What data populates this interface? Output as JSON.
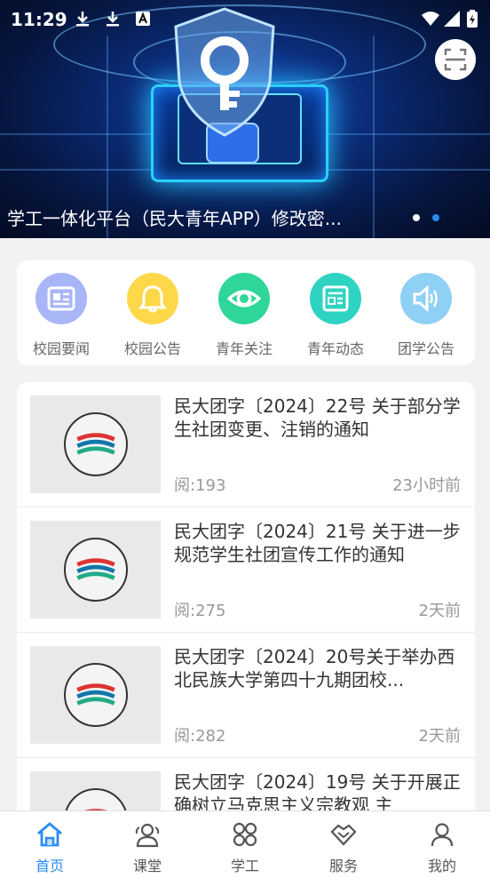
{
  "status_bar": {
    "time": "11:29"
  },
  "banner": {
    "caption": "学工一体化平台（民大青年APP）修改密...",
    "dots": 2,
    "active_dot": 2
  },
  "quick_menu": [
    {
      "label": "校园要闻",
      "icon": "newspaper-icon",
      "color": "#a8b5f6"
    },
    {
      "label": "校园公告",
      "icon": "bell-icon",
      "color": "#ffd84a"
    },
    {
      "label": "青年关注",
      "icon": "eye-icon",
      "color": "#2fd69a"
    },
    {
      "label": "青年动态",
      "icon": "news-feed-icon",
      "color": "#2fd3c2"
    },
    {
      "label": "团学公告",
      "icon": "speaker-icon",
      "color": "#8fd0f5"
    }
  ],
  "news": [
    {
      "title": "民大团字〔2024〕22号 关于部分学生社团变更、注销的通知",
      "reads": "阅:193",
      "time": "23小时前"
    },
    {
      "title": "民大团字〔2024〕21号 关于进一步规范学生社团宣传工作的通知",
      "reads": "阅:275",
      "time": "2天前"
    },
    {
      "title": "民大团字〔2024〕20号关于举办西北民族大学第四十九期团校...",
      "reads": "阅:282",
      "time": "2天前"
    },
    {
      "title": "民大团字〔2024〕19号 关于开展正确树立马克思主义宗教观 主",
      "reads": "",
      "time": ""
    }
  ],
  "tabbar": [
    {
      "label": "首页",
      "icon": "home-icon",
      "active": true
    },
    {
      "label": "课堂",
      "icon": "people-icon",
      "active": false
    },
    {
      "label": "学工",
      "icon": "grid-icon",
      "active": false
    },
    {
      "label": "服务",
      "icon": "handshake-icon",
      "active": false
    },
    {
      "label": "我的",
      "icon": "person-icon",
      "active": false
    }
  ],
  "colors": {
    "accent": "#2a8cf0",
    "text_muted": "#999999"
  }
}
